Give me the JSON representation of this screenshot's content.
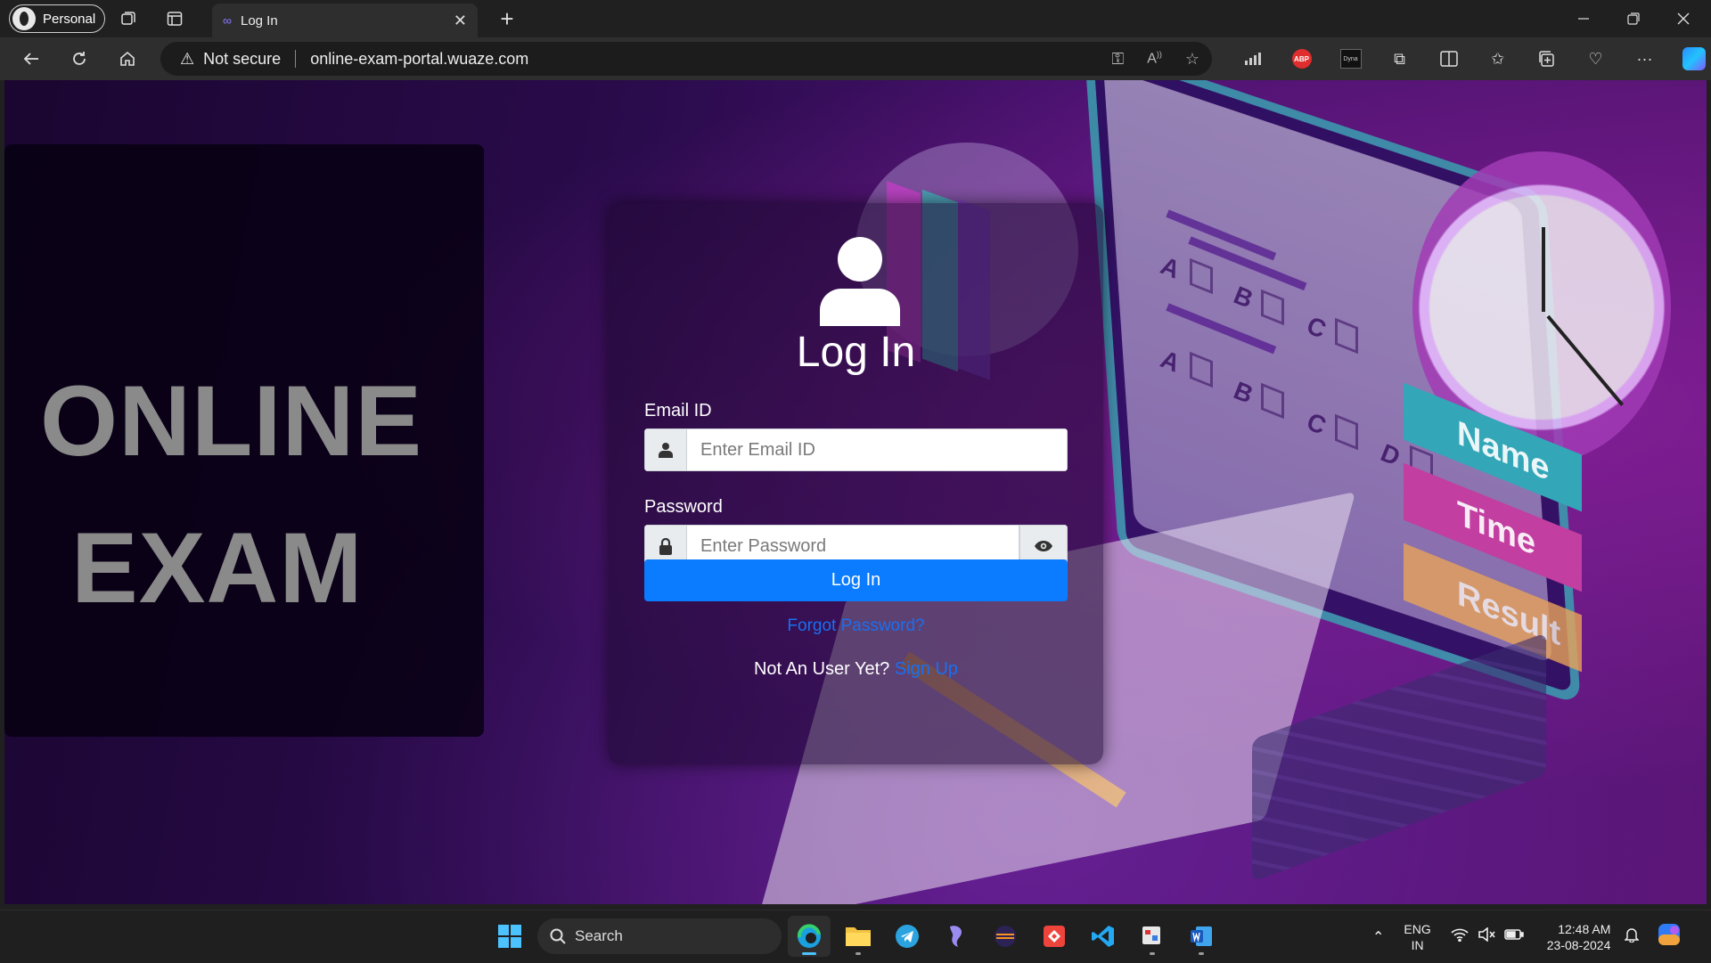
{
  "browser": {
    "profile_label": "Personal",
    "tab_title": "Log In",
    "security_label": "Not secure",
    "url": "online-exam-portal.wuaze.com",
    "extensions": {
      "abp_label": "ABP",
      "dyna_label": "Dyna"
    }
  },
  "page": {
    "brand_line1": "ONLINE",
    "brand_line2": "EXAM",
    "title": "Log In",
    "email_label": "Email ID",
    "email_placeholder": "Enter Email ID",
    "password_label": "Password",
    "password_placeholder": "Enter Password",
    "login_button": "Log In",
    "forgot_link": "Forgot Password?",
    "signup_prompt": "Not An User Yet?",
    "signup_link": "Sign Up",
    "illustration": {
      "tags": [
        "Name",
        "Time",
        "Result"
      ],
      "options": [
        "A",
        "B",
        "C",
        "D"
      ]
    }
  },
  "taskbar": {
    "search_label": "Search",
    "lang_line1": "ENG",
    "lang_line2": "IN",
    "time": "12:48 AM",
    "date": "23-08-2024"
  },
  "colors": {
    "primary_button": "#0b7cff",
    "link": "#1a6ff0"
  }
}
